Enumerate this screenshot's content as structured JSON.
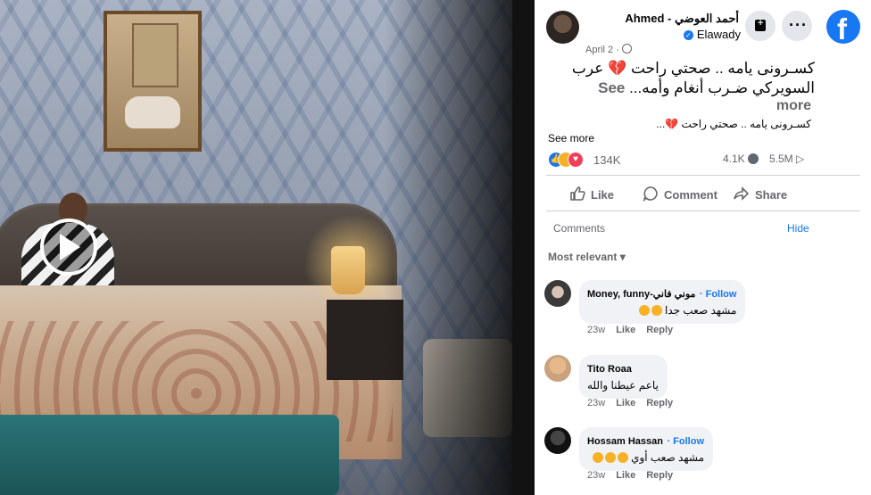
{
  "post": {
    "author": "Ahmed - أحمد العوضي",
    "page": "Elawady",
    "date": "April 2 ·",
    "caption": "كسـرونى يامه .. صحتي راحت 💔 عرب السويركي ضـرب أنغام وأمه...",
    "see_inline": "See",
    "see_more_second_line": "more",
    "caption_translation": "كسـرونى يامه .. صحتي راحت 💔...",
    "see_more": "See more",
    "reactions_count": "134K",
    "comments_count": "4.1K",
    "views_count": "5.5M"
  },
  "actions": {
    "like": "Like",
    "comment": "Comment",
    "share": "Share"
  },
  "comments_section": {
    "title": "Comments",
    "hide": "Hide",
    "sort": "Most relevant"
  },
  "comments": [
    {
      "name": "Money, funny-موني فاني",
      "follow": "· Follow",
      "text": "مشهد صعب جدا",
      "time": "23w",
      "like": "Like",
      "reply": "Reply"
    },
    {
      "name": "Tito Roaa",
      "follow": "",
      "text": "ياعم عيطنا والله",
      "time": "23w",
      "like": "Like",
      "reply": "Reply"
    },
    {
      "name": "Hossam Hassan",
      "follow": "· Follow",
      "text": "مشهد صعب أوي",
      "time": "23w",
      "like": "Like",
      "reply": "Reply"
    }
  ],
  "icons": {
    "logo": "facebook-logo",
    "save": "bag-plus-icon",
    "more": "more-horizontal-icon",
    "play": "play-icon"
  },
  "colors": {
    "brand": "#1877f2",
    "secondary_text": "#65676b",
    "comment_bubble": "#f0f2f5"
  },
  "brand_letter": "f",
  "more_dots": "···"
}
